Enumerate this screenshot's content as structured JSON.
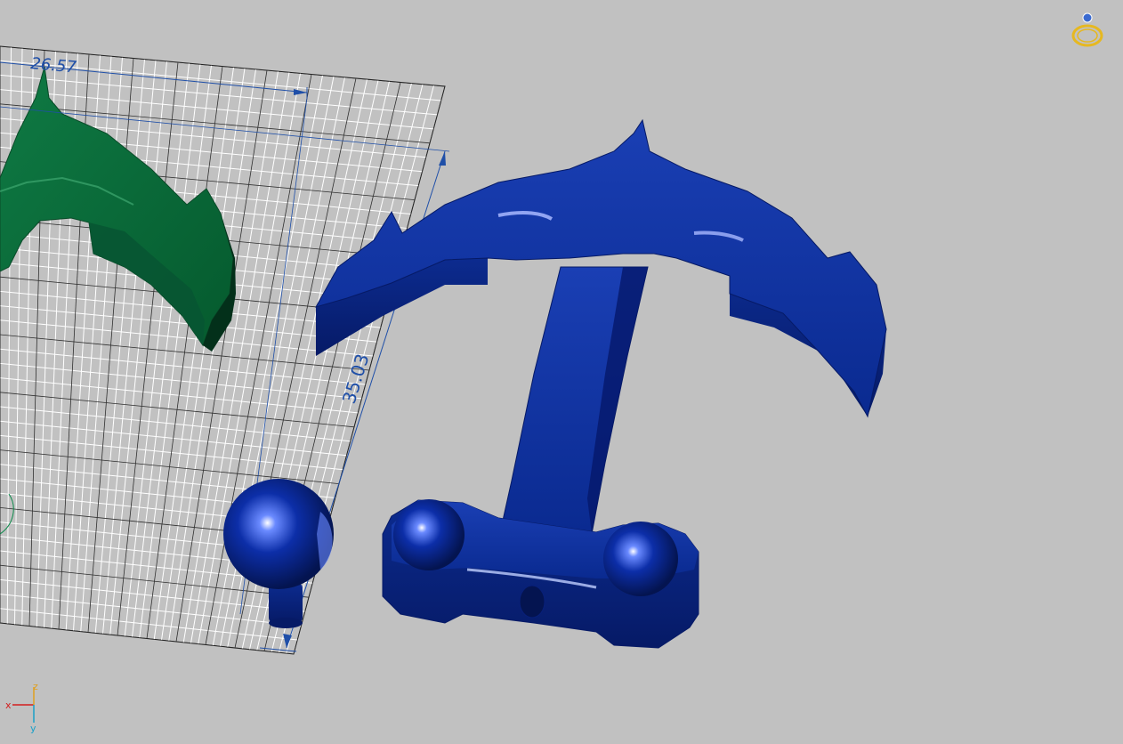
{
  "viewport": {
    "background": "#c1c1c1",
    "grid_color": "#ffffff",
    "grid_outline_color": "#202020"
  },
  "dimensions": {
    "width_value": "26.57",
    "height_value": "35.03",
    "color": "#1f4fa8"
  },
  "objects": {
    "anchor_color": "#0a2a90",
    "arrow_color": "#0b6a3a",
    "sphere_color": "#0a2a90"
  },
  "axis_triad": {
    "x_label": "x",
    "y_label": "y",
    "z_label": "z",
    "x_color": "#d21f1f",
    "y_color": "#1aa0c8",
    "z_color": "#e0a020"
  },
  "view_cube": {
    "icon": "orbit-ring-icon",
    "color": "#e6b820"
  }
}
